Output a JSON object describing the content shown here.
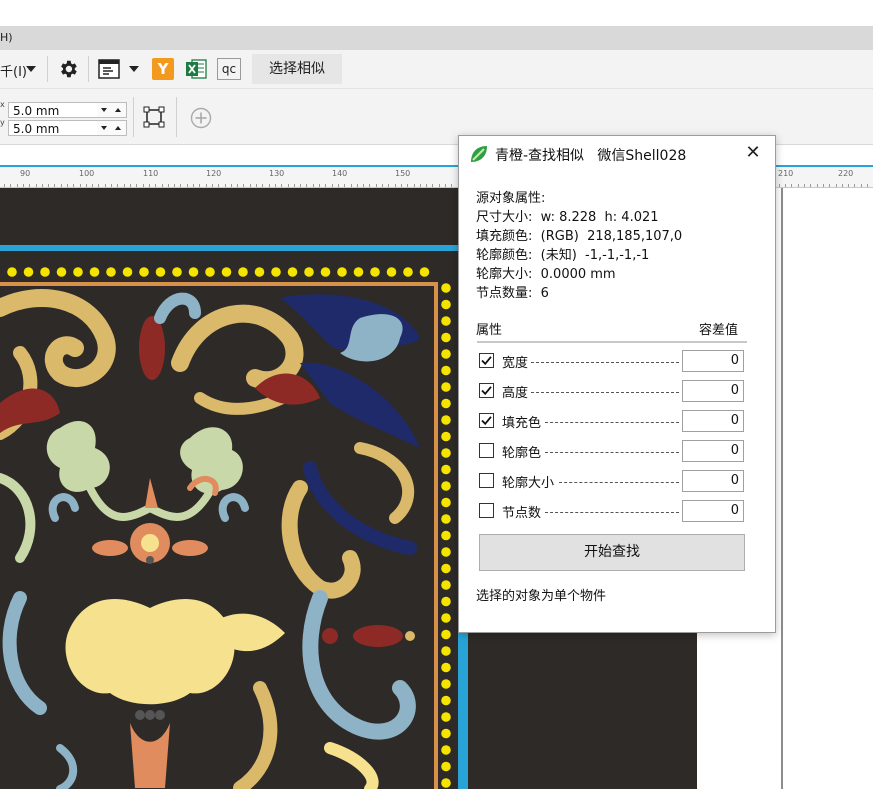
{
  "menubar": {
    "partial_item": "H)"
  },
  "toolbar1": {
    "partial_item": "千(I)",
    "select_similar_label": "选择相似",
    "qc_label": "qc",
    "y_label": "Y"
  },
  "toolbar2": {
    "width_value": "5.0 mm",
    "height_value": "5.0 mm",
    "x_axis_label": "x",
    "y_axis_label": "y"
  },
  "ruler": {
    "labels": [
      "90",
      "100",
      "110",
      "120",
      "130",
      "140",
      "150",
      "210",
      "220"
    ]
  },
  "dialog": {
    "title": "青橙-查找相似   微信Shell028",
    "close_symbol": "✕",
    "source_heading": "源对象属性:",
    "size_line": "尺寸大小:  w: 8.228  h: 4.021",
    "fill_line": "填充颜色:  (RGB)  218,185,107,0",
    "outline_color_line": "轮廓颜色:  (未知)  -1,-1,-1,-1",
    "outline_size_line": "轮廓大小:  0.0000 mm",
    "node_count_line": "节点数量:  6",
    "header_property": "属性",
    "header_tolerance": "容差值",
    "rows": [
      {
        "label": "宽度",
        "checked": true,
        "tolerance": "0"
      },
      {
        "label": "高度",
        "checked": true,
        "tolerance": "0"
      },
      {
        "label": "填充色",
        "checked": true,
        "tolerance": "0"
      },
      {
        "label": "轮廓色",
        "checked": false,
        "tolerance": "0"
      },
      {
        "label": "轮廓大小",
        "checked": false,
        "tolerance": "0"
      },
      {
        "label": "节点数",
        "checked": false,
        "tolerance": "0"
      }
    ],
    "start_button": "开始查找",
    "status": "选择的对象为单个物件"
  },
  "colors": {
    "accent_blue": "#29a3d6",
    "artwork_background": "#2e2a27",
    "ornament_gold": "#dab96b",
    "ornament_navy": "#1f2a6b",
    "ornament_red": "#8e2a25",
    "ornament_pale_blue": "#8fb3c6",
    "ornament_sage": "#c9d8a8",
    "ornament_yellow": "#f6e28e",
    "dot_yellow": "#f5e400",
    "border_orange": "#d9904a"
  },
  "icons": {
    "gear": "gear-icon",
    "text_layout": "text-frame-icon",
    "yonghong": "y-plugin-icon",
    "excel": "excel-icon",
    "bounding_box": "bounding-box-icon",
    "add": "add-circle-icon",
    "app_logo": "qingcheng-logo-icon"
  }
}
